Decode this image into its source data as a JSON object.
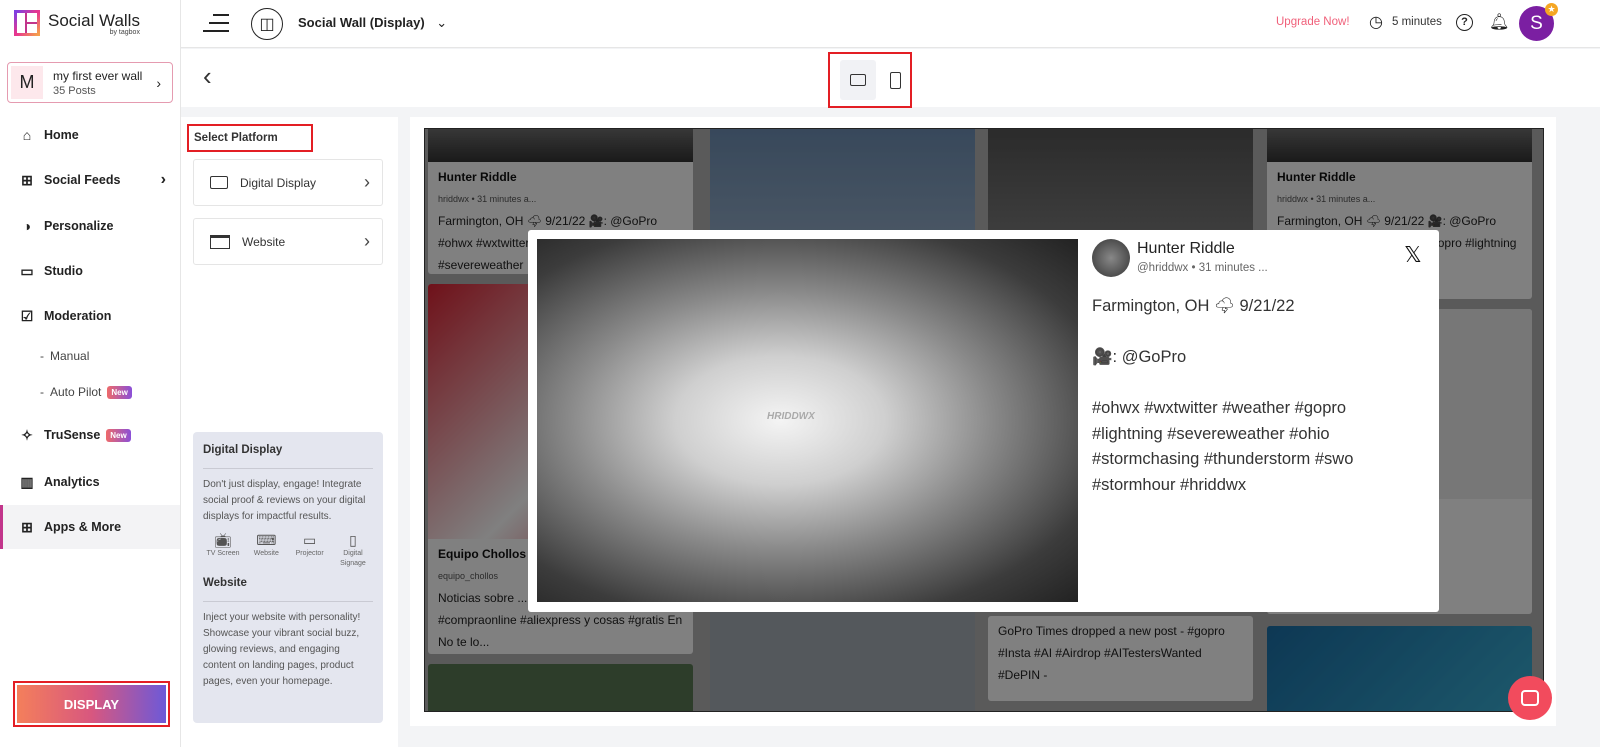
{
  "app": {
    "title": "Social Walls",
    "subtitle": "by tagbox"
  },
  "wall": {
    "initial": "M",
    "name": "my first ever wall",
    "posts": "35 Posts"
  },
  "nav": [
    {
      "label": "Home",
      "icon": "home-icon",
      "glyph": "⌂"
    },
    {
      "label": "Social Feeds",
      "icon": "add-feed-icon",
      "glyph": "⊞"
    },
    {
      "label": "Personalize",
      "icon": "drop-icon",
      "glyph": "◑"
    },
    {
      "label": "Studio",
      "icon": "monitor-icon",
      "glyph": "▭"
    },
    {
      "label": "Moderation",
      "icon": "moderation-icon",
      "glyph": "☑"
    },
    {
      "label": "TruSense",
      "icon": "sparkle-icon",
      "glyph": "✧"
    },
    {
      "label": "Analytics",
      "icon": "bar-chart-icon",
      "glyph": "▥"
    },
    {
      "label": "Apps & More",
      "icon": "apps-icon",
      "glyph": "⊞"
    }
  ],
  "subnav": [
    {
      "label": "Manual"
    },
    {
      "label": "Auto Pilot",
      "badge": "New"
    }
  ],
  "trusense_badge": "New",
  "display_button": "DISPLAY",
  "header": {
    "wall_type": "Social Wall (Display)",
    "upgrade": "Upgrade Now!",
    "timer": "5 minutes",
    "avatar": "S"
  },
  "panel": {
    "title": "Select Platform",
    "options": [
      {
        "label": "Digital Display"
      },
      {
        "label": "Website"
      }
    ],
    "info": {
      "dd_title": "Digital Display",
      "dd_text": "Don't just display, engage! Integrate social proof & reviews on your digital displays for impactful results.",
      "devices": [
        "TV Screen",
        "Website",
        "Projector",
        "Digital Signage"
      ],
      "web_title": "Website",
      "web_text": "Inject your website with personality! Showcase your vibrant social buzz, glowing reviews, and engaging content on landing pages, product pages, even your homepage."
    }
  },
  "wall_posts": [
    {
      "name": "Hunter Riddle",
      "handle": "hriddwx • 31 minutes a...",
      "text": "Farmington, OH 🌩 9/21/22 🎥: @GoPro #ohwx #wxtwitter #weather #gopro #lightning #severeweather"
    },
    {
      "name": "Equipo Chollos",
      "handle": "equipo_chollos",
      "text": "Noticias sobre ... #ofertas #chollos #compraonline #aliexpress y cosas #gratis En No te lo..."
    },
    {
      "name": "",
      "handle": "",
      "text": "GoPro Times dropped a new post - #gopro #Insta #AI #Airdrop #AITestersWanted #DePIN -"
    },
    {
      "name": "Hunter Riddle",
      "handle": "hriddwx • 31 minutes a...",
      "text": "Farmington, OH 🌩 9/21/22 🎥: @GoPro #ohwx #wxtwitter #weather #gopro #lightning #severeweather #ohio..."
    }
  ],
  "modal": {
    "name": "Hunter Riddle",
    "handle": "@hriddwx • 31 minutes ...",
    "line1": "Farmington, OH 🌩 9/21/22",
    "line2": "🎥: @GoPro",
    "tags": "#ohwx #wxtwitter #weather #gopro #lightning #severeweather #ohio #stormchasing #thunderstorm #swo #stormhour #hriddwx",
    "watermark": "HRIDDWX"
  }
}
